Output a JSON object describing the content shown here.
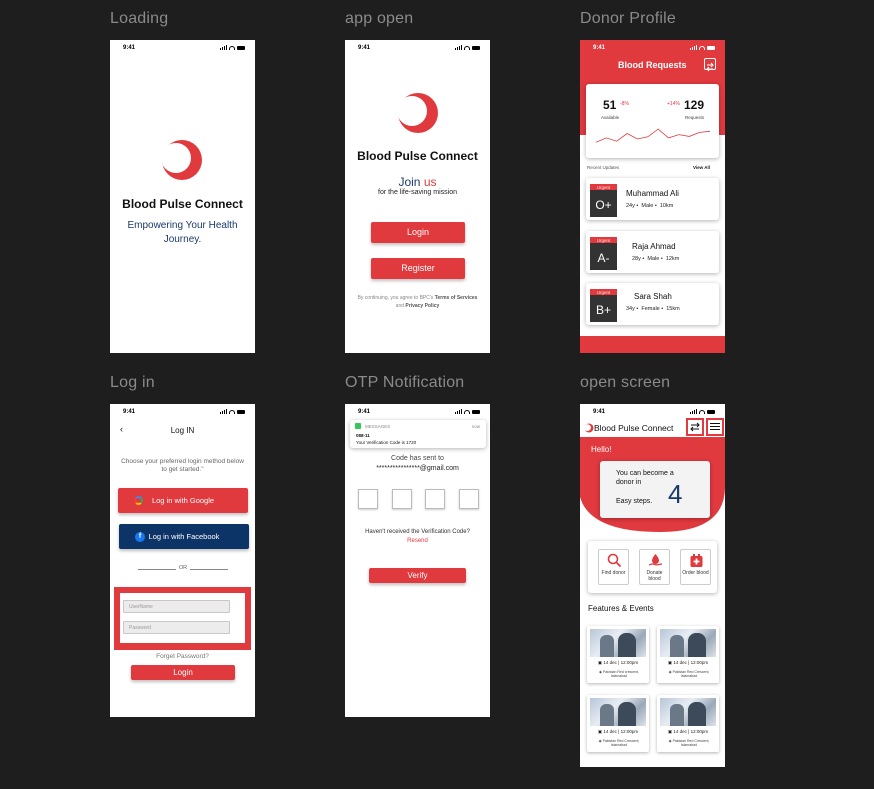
{
  "frames": {
    "loading": {
      "title": "Loading",
      "time": "9:41",
      "app_name": "Blood Pulse Connect",
      "tagline": "Empowering Your Health Journey."
    },
    "app_open": {
      "title": "app open",
      "time": "9:41",
      "app_name": "Blood Pulse Connect",
      "join_text": "Join",
      "join_us": "us",
      "mission": "for the life-saving mission",
      "login_label": "Login",
      "register_label": "Register",
      "terms_prefix": "By continuing, you agree to BPC's",
      "terms_link": "Terms of Services",
      "terms_and": "and",
      "privacy_link": "Privacy Policy"
    },
    "donor_profile": {
      "title": "Donor Profile",
      "time": "9:41",
      "header": "Blood Requests",
      "available_value": "51",
      "available_change": "-8%",
      "available_label": "Available",
      "requests_change": "+14%",
      "requests_value": "129",
      "requests_label": "Requests",
      "recent_label": "Recent Updates",
      "view_all": "View All",
      "donors": [
        {
          "urgent": "Urgent",
          "blood": "O+",
          "name": "Muhammad Ali",
          "age": "24y",
          "gender": "Male",
          "distance": "10km"
        },
        {
          "urgent": "Urgent",
          "blood": "A-",
          "name": "Raja Ahmad",
          "age": "28y",
          "gender": "Male",
          "distance": "12km"
        },
        {
          "urgent": "Urgent",
          "blood": "B+",
          "name": "Sara Shah",
          "age": "34y",
          "gender": "Female",
          "distance": "15km"
        }
      ],
      "trend_points": [
        0.35,
        0.55,
        0.4,
        0.75,
        0.5,
        0.6,
        0.95,
        0.55,
        0.7,
        0.62,
        0.8,
        0.85
      ]
    },
    "login": {
      "title": "Log in",
      "time": "9:41",
      "header": "Log IN",
      "instruction": "Choose your preferred login method below to get started.\"",
      "google_label": "Log in with Google",
      "facebook_label": "Log in with Facebook",
      "or_label": "OR",
      "username_placeholder": "UserName",
      "password_placeholder": "Password",
      "forgot": "Forget Password?",
      "login_label": "Login"
    },
    "otp": {
      "title": "OTP Notification",
      "time": "9:41",
      "notif_app": "MESSAGES",
      "notif_time": "now",
      "notif_sender": "088-11",
      "notif_body": "Your Verification Code is 1720",
      "code_sent": "Code has sent to",
      "email": "****************@gmail.com",
      "not_received": "Haven't received the Verification Code?",
      "resend": "Resend",
      "verify_label": "Verify"
    },
    "open_screen": {
      "title": "open screen",
      "time": "9:41",
      "app_name": "Blood Pulse Connect",
      "hello": "Hello!",
      "donor_line1": "You can become a donor in",
      "donor_line2": "Easy steps.",
      "donor_steps": "4",
      "services": [
        {
          "label": "Find donor",
          "icon": "search-icon"
        },
        {
          "label": "Donate blood",
          "icon": "donate-icon"
        },
        {
          "label": "Order blood",
          "icon": "order-icon"
        }
      ],
      "events_title": "Features & Events",
      "events": [
        {
          "date": "14 dec | 12:00pm",
          "location": "Pakistan Red crescent, Islamabad"
        },
        {
          "date": "14 dec | 12:00pm",
          "location": "Pakistan Red Crescent, Islamabad"
        },
        {
          "date": "14 dec | 12:00pm",
          "location": "Pakistan Red Crescent, Islamabad"
        },
        {
          "date": "14 dec | 12:00pm",
          "location": "Pakistan Red Crescent, Islamabad"
        }
      ]
    }
  },
  "colors": {
    "brand_red": "#e0393e",
    "facebook_blue": "#0d3466",
    "canvas": "#1e1e1e",
    "dark_badge": "#333333"
  }
}
